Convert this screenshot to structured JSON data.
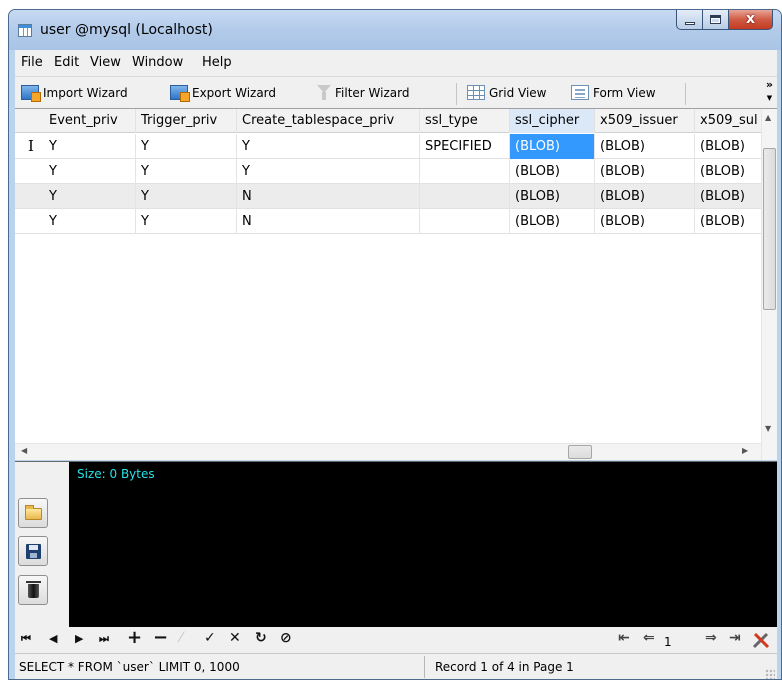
{
  "window": {
    "title": "user @mysql (Localhost)",
    "close_glyph": "x"
  },
  "menu": [
    "File",
    "Edit",
    "View",
    "Window",
    "Help"
  ],
  "toolbar": {
    "import_label": "Import Wizard",
    "export_label": "Export Wizard",
    "filter_label": "Filter Wizard",
    "grid_view_label": "Grid View",
    "form_view_label": "Form View",
    "overflow": "»"
  },
  "table": {
    "columns": [
      "Event_priv",
      "Trigger_priv",
      "Create_tablespace_priv",
      "ssl_type",
      "ssl_cipher",
      "x509_issuer",
      "x509_sul"
    ],
    "selected_column": "ssl_cipher",
    "rows": [
      [
        "Y",
        "Y",
        "Y",
        "SPECIFIED",
        "(BLOB)",
        "(BLOB)",
        "(BLOB)"
      ],
      [
        "Y",
        "Y",
        "Y",
        "",
        "(BLOB)",
        "(BLOB)",
        "(BLOB)"
      ],
      [
        "Y",
        "Y",
        "N",
        "",
        "(BLOB)",
        "(BLOB)",
        "(BLOB)"
      ],
      [
        "Y",
        "Y",
        "N",
        "",
        "(BLOB)",
        "(BLOB)",
        "(BLOB)"
      ]
    ],
    "current_row_marker": "I"
  },
  "blob_panel": {
    "size_text": "Size: 0 Bytes"
  },
  "navigator": {
    "first": "⏮",
    "prev": "◀",
    "next": "▶",
    "last": "⏭",
    "add": "+",
    "delete": "−",
    "edit": "⁄",
    "post": "✓",
    "cancel": "✕",
    "refresh": "↻",
    "stop": "⊘",
    "page_first": "⇤",
    "page_prev": "⇐",
    "page_number": "1",
    "page_next": "⇒",
    "page_last": "⇥"
  },
  "status": {
    "sql": "SELECT * FROM `user` LIMIT 0, 1000",
    "record": "Record 1 of 4 in Page 1"
  },
  "colors": {
    "selection": "#3399ff",
    "blob_text": "#27e2e8",
    "title_bar": "#b9cfec"
  }
}
